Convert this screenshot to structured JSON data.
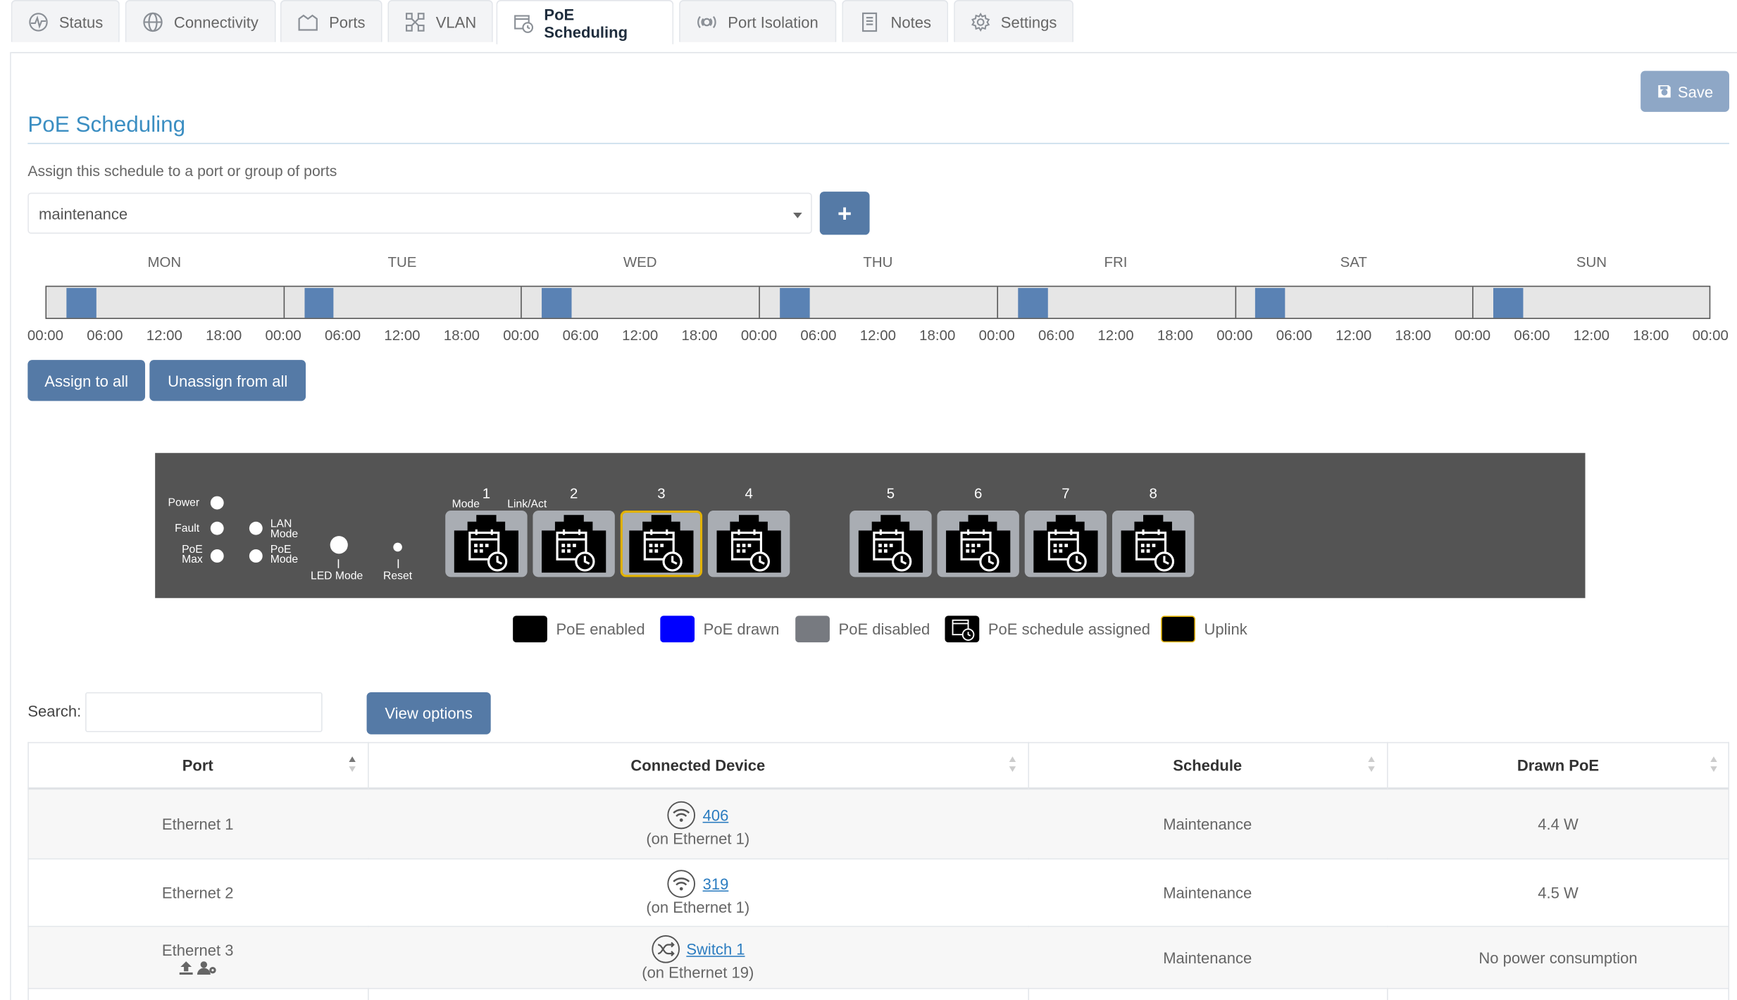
{
  "tabs": [
    {
      "label": "Status",
      "icon": "status-icon"
    },
    {
      "label": "Connectivity",
      "icon": "globe-icon"
    },
    {
      "label": "Ports",
      "icon": "ports-icon"
    },
    {
      "label": "VLAN",
      "icon": "vlan-icon"
    },
    {
      "label": "PoE Scheduling",
      "icon": "poe-schedule-icon",
      "active": true
    },
    {
      "label": "Port Isolation",
      "icon": "port-isolation-icon"
    },
    {
      "label": "Notes",
      "icon": "notes-icon"
    },
    {
      "label": "Settings",
      "icon": "gear-icon"
    }
  ],
  "toolbar": {
    "save_label": "Save"
  },
  "page": {
    "title": "PoE Scheduling",
    "assign_text": "Assign this schedule to a port or group of ports",
    "schedule_select_value": "maintenance",
    "add_label": "+",
    "assign_all_label": "Assign to all",
    "unassign_all_label": "Unassign from all"
  },
  "timeline": {
    "days": [
      "MON",
      "TUE",
      "WED",
      "THU",
      "FRI",
      "SAT",
      "SUN"
    ],
    "ticks": [
      "00:00",
      "06:00",
      "12:00",
      "18:00",
      "00:00",
      "06:00",
      "12:00",
      "18:00",
      "00:00",
      "06:00",
      "12:00",
      "18:00",
      "00:00",
      "06:00",
      "12:00",
      "18:00",
      "00:00",
      "06:00",
      "12:00",
      "18:00",
      "00:00",
      "06:00",
      "12:00",
      "18:00",
      "00:00",
      "06:00",
      "12:00",
      "18:00",
      "00:00"
    ],
    "scheduled_window": {
      "start": "02:00",
      "end": "05:00"
    }
  },
  "panel": {
    "leds": {
      "power": "Power",
      "fault": "Fault",
      "poe_max_1": "PoE",
      "poe_max_2": "Max",
      "lan_mode_1": "LAN",
      "lan_mode_2": "Mode",
      "poe_mode_1": "PoE",
      "poe_mode_2": "Mode",
      "led_mode": "LED Mode",
      "reset": "Reset",
      "mode": "Mode",
      "link_act": "Link/Act"
    },
    "ports": [
      "1",
      "2",
      "3",
      "4",
      "5",
      "6",
      "7",
      "8"
    ],
    "uplink_port": "3"
  },
  "legend": {
    "poe_enabled": "PoE enabled",
    "poe_drawn": "PoE drawn",
    "poe_disabled": "PoE disabled",
    "poe_schedule": "PoE schedule assigned",
    "uplink": "Uplink"
  },
  "search": {
    "label": "Search:",
    "placeholder": ""
  },
  "view_options_label": "View options",
  "table": {
    "headers": {
      "port": "Port",
      "device": "Connected Device",
      "schedule": "Schedule",
      "drawn": "Drawn PoE"
    },
    "rows": [
      {
        "port": "Ethernet 1",
        "device": "406",
        "device_icon": "wifi-icon",
        "via": "(on Ethernet 1)",
        "schedule": "Maintenance",
        "drawn": "4.4 W"
      },
      {
        "port": "Ethernet 2",
        "device": "319",
        "device_icon": "wifi-icon",
        "via": "(on Ethernet 1)",
        "schedule": "Maintenance",
        "drawn": "4.5 W"
      },
      {
        "port": "Ethernet 3",
        "device": "Switch 1",
        "device_icon": "switch-icon",
        "via": "(on Ethernet 19)",
        "schedule": "Maintenance",
        "drawn": "No power consumption"
      }
    ]
  },
  "colors": {
    "accent": "#3b8ec2",
    "button": "#557aa6",
    "save_disabled": "#8ea7c6",
    "schedule_block": "#5a82b4",
    "panel": "#545454",
    "uplink": "#e2b200",
    "poe_drawn": "#0000ff"
  }
}
